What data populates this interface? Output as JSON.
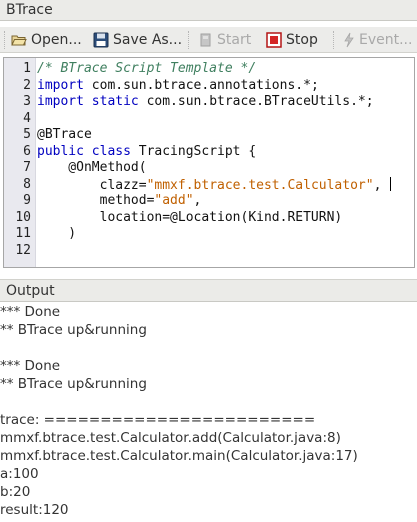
{
  "window": {
    "title": "BTrace"
  },
  "toolbar": {
    "open_label": "Open...",
    "save_as_label": "Save As...",
    "start_label": "Start",
    "stop_label": "Stop",
    "events_label": "Event..."
  },
  "editor": {
    "line_numbers": [
      "1",
      "2",
      "3",
      "4",
      "5",
      "6",
      "7",
      "8",
      "9",
      "10",
      "11",
      "12"
    ],
    "lines": [
      [
        {
          "t": "/* BTrace Script Template */",
          "c": "cm"
        }
      ],
      [
        {
          "t": "import",
          "c": "kw"
        },
        {
          "t": " com.sun.btrace.annotations.*;",
          "c": ""
        }
      ],
      [
        {
          "t": "import static",
          "c": "kw"
        },
        {
          "t": " com.sun.btrace.BTraceUtils.*;",
          "c": ""
        }
      ],
      [],
      [
        {
          "t": "@BTrace",
          "c": ""
        }
      ],
      [
        {
          "t": "public class",
          "c": "kw"
        },
        {
          "t": " TracingScript {",
          "c": ""
        }
      ],
      [
        {
          "t": "    @OnMethod(",
          "c": ""
        }
      ],
      [
        {
          "t": "        clazz=",
          "c": ""
        },
        {
          "t": "\"mmxf.btrace.test.Calculator\"",
          "c": "str"
        },
        {
          "t": ", ",
          "c": ""
        },
        {
          "t": "",
          "c": "caret"
        }
      ],
      [
        {
          "t": "        method=",
          "c": ""
        },
        {
          "t": "\"add\"",
          "c": "str"
        },
        {
          "t": ",",
          "c": ""
        }
      ],
      [
        {
          "t": "        location=@Location(Kind.RETURN)",
          "c": ""
        }
      ],
      [
        {
          "t": "    )",
          "c": ""
        }
      ],
      []
    ]
  },
  "output": {
    "title": "Output",
    "lines": [
      "*** Done",
      "** BTrace up&running",
      "",
      "*** Done",
      "** BTrace up&running",
      "",
      "trace: ========================",
      "mmxf.btrace.test.Calculator.add(Calculator.java:8)",
      "mmxf.btrace.test.Calculator.main(Calculator.java:17)",
      "a:100",
      "b:20",
      "result:120"
    ]
  }
}
